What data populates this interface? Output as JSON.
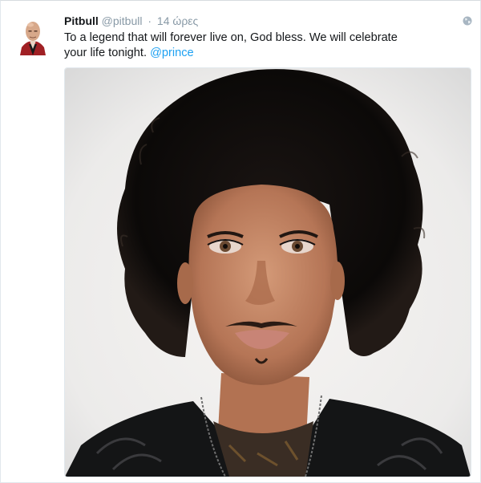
{
  "tweet": {
    "display_name": "Pitbull",
    "handle": "@pitbull",
    "separator": "·",
    "timestamp": "14 ώρες",
    "text_before_mention": "To a legend that will forever live on, God bless. We will celebrate your life tonight. ",
    "mention": "@prince"
  },
  "icons": {
    "avatar": "user-avatar",
    "globe": "globe-icon",
    "media": "tweet-photo"
  },
  "colors": {
    "link": "#1da1f2",
    "muted": "#8899a6",
    "text": "#14171a",
    "card_bg": "#ffffff",
    "page_bg": "#e8ecee"
  }
}
